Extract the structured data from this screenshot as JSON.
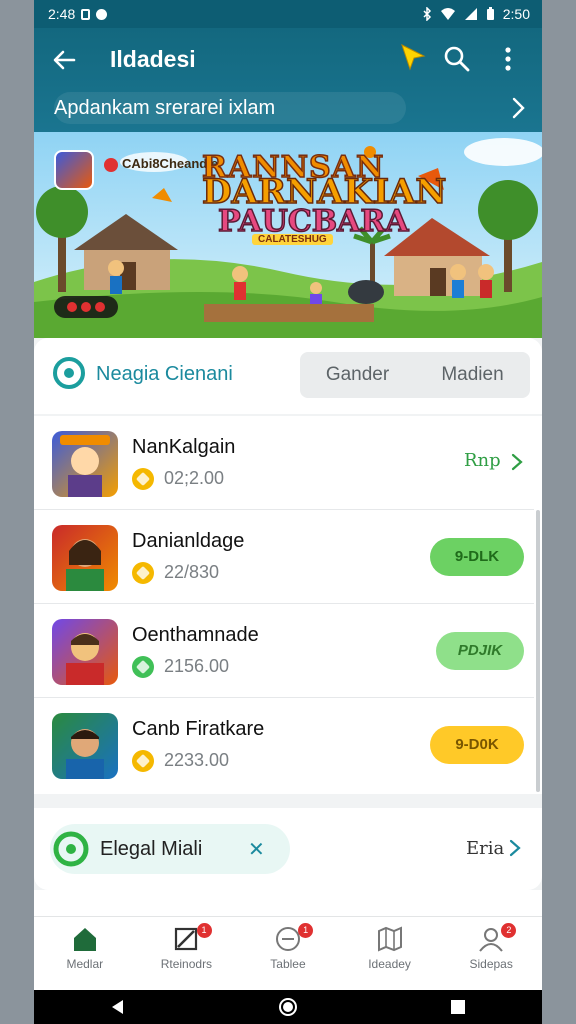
{
  "status_bar": {
    "time": "2:48",
    "right_time": "2:50"
  },
  "header": {
    "title": "Ildadesi",
    "subtitle": "Apdankam srerarei ixlam"
  },
  "banner": {
    "studio": "CAbi8Cheandie",
    "title_line1": "RANNSAN",
    "title_line2": "DARNAKIAN",
    "title_line3": "PAUCBARA",
    "tagline": "CALATESHUG"
  },
  "section": {
    "name": "Neagia Cienani",
    "segments": [
      "Gander",
      "Madien"
    ]
  },
  "list": [
    {
      "name": "NanKalgain",
      "price": "02;2.00",
      "coin_color": "#f5b800",
      "action": "Rnp",
      "action_type": "link",
      "art": [
        "#3b5bdb",
        "#f59f00"
      ]
    },
    {
      "name": "Danianldage",
      "price": "22/830",
      "coin_color": "#f5b800",
      "action": "9-DLK",
      "action_type": "green",
      "art": [
        "#c92a2a",
        "#f08c00"
      ]
    },
    {
      "name": "Oenthamnade",
      "price": "2156.00",
      "coin_color": "#40c057",
      "action": "PDJIK",
      "action_type": "lightgreen",
      "art": [
        "#7048e8",
        "#e8590c"
      ]
    },
    {
      "name": "Canb Firatkare",
      "price": "2233.00",
      "coin_color": "#f5b800",
      "action": "9-D0K",
      "action_type": "yellow",
      "art": [
        "#2b8a3e",
        "#1971c2"
      ]
    }
  ],
  "promo": {
    "chip_label": "Elegal Miali",
    "more": "Eria"
  },
  "bottom_nav": [
    {
      "label": "Medlar",
      "icon": "home-icon",
      "active": true,
      "badge": ""
    },
    {
      "label": "Rteinodrs",
      "icon": "edit-icon",
      "active": false,
      "badge": "1"
    },
    {
      "label": "Tablee",
      "icon": "add-circle-icon",
      "active": false,
      "badge": "1"
    },
    {
      "label": "Ideadey",
      "icon": "map-icon",
      "active": false,
      "badge": ""
    },
    {
      "label": "Sidepas",
      "icon": "profile-icon",
      "active": false,
      "badge": "2"
    }
  ],
  "colors": {
    "appbar": "#13687f",
    "accent": "#1b8a9e",
    "green_button": "#6cd163",
    "light_green_button": "#8fe08a",
    "yellow_button": "#ffc928"
  }
}
